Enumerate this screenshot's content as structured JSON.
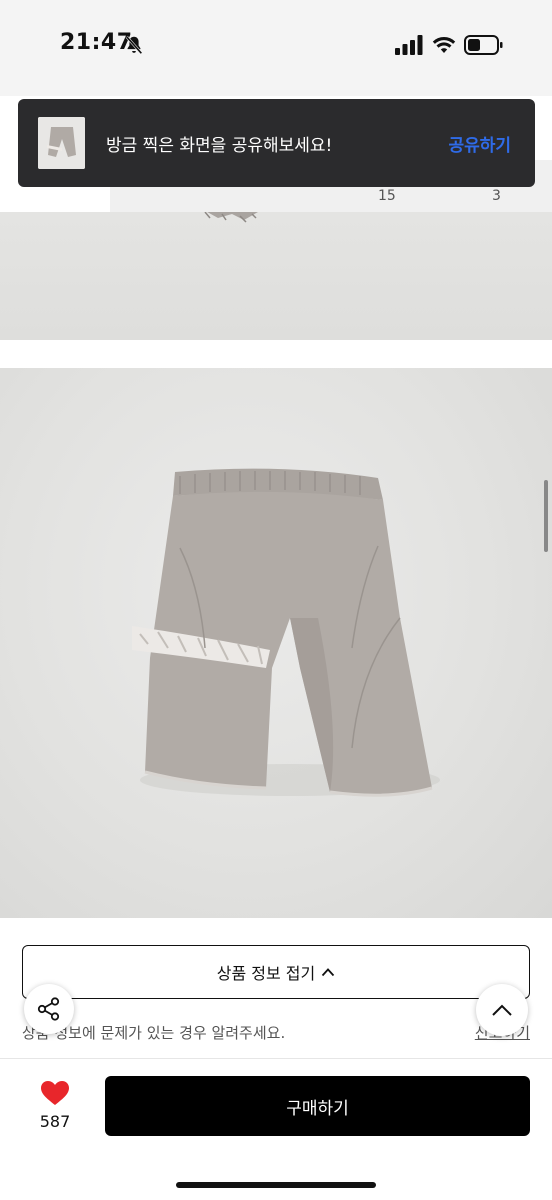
{
  "status_bar": {
    "time": "21:47",
    "icons": [
      "bell-slash-icon",
      "signal-icon",
      "wifi-icon",
      "battery-icon"
    ]
  },
  "toast": {
    "message": "방금 찍은 화면을 공유해보세요!",
    "action_label": "공유하기",
    "action_color": "#2f6be8",
    "background": "#2b2b2d"
  },
  "tabs": {
    "counts": [
      "15",
      "3"
    ]
  },
  "product_info": {
    "fold_label": "상품 정보 접기",
    "report_text": "상품 정보에 문제가 있는 경우 알려주세요.",
    "report_link": "신고하기"
  },
  "bottom_bar": {
    "like_count": "587",
    "like_color": "#e8262b",
    "buy_label": "구매하기"
  }
}
